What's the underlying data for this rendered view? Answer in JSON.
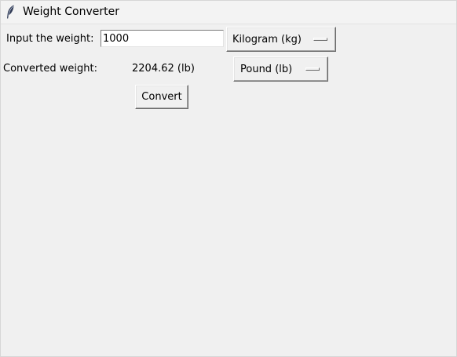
{
  "window": {
    "title": "Weight Converter",
    "icon": "feather-icon"
  },
  "input": {
    "label": "Input the weight:",
    "value": "1000",
    "unit_selected": "Kilogram (kg)"
  },
  "output": {
    "label": "Converted weight:",
    "value": "2204.62 (lb)",
    "unit_selected": "Pound (lb)"
  },
  "actions": {
    "convert_label": "Convert"
  }
}
